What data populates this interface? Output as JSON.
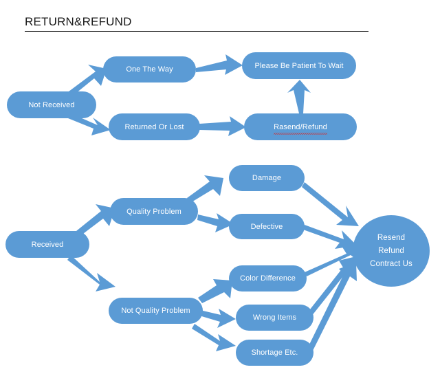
{
  "document": {
    "title": "RETURN&REFUND",
    "has_title_rule": true
  },
  "theme": {
    "node_fill": "#5B9BD5",
    "node_text": "#FFFFFF",
    "arrow_fill": "#5B9BD5",
    "page_background": "#FFFFFF",
    "title_text": "#1A1A1A",
    "spellcheck_underline": "#D42B2B"
  },
  "diagram": {
    "type": "flowchart",
    "branches": [
      {
        "name": "not-received-branch",
        "root": "Not Received",
        "steps": [
          "One The Way",
          "Returned Or Lost",
          "Please Be Patient To Wait",
          "Rasend/Refund"
        ]
      },
      {
        "name": "received-branch",
        "root": "Received",
        "steps": [
          "Quality Problem",
          "Not Quality Problem",
          "Damage",
          "Defective",
          "Color Difference",
          "Wrong Items",
          "Shortage Etc.",
          "Resend Refund Contract Us"
        ]
      }
    ],
    "nodes": [
      {
        "id": "not-received",
        "label": "Not Received",
        "shape": "rounded-rect"
      },
      {
        "id": "one-the-way",
        "label": "One The Way",
        "shape": "rounded-rect"
      },
      {
        "id": "returned-or-lost",
        "label": "Returned Or Lost",
        "shape": "rounded-rect"
      },
      {
        "id": "please-be-patient",
        "label": "Please Be Patient To Wait",
        "shape": "rounded-rect"
      },
      {
        "id": "rasend-refund",
        "label": "Rasend/Refund",
        "shape": "rounded-rect",
        "misspelled": true
      },
      {
        "id": "received",
        "label": "Received",
        "shape": "rounded-rect"
      },
      {
        "id": "quality-problem",
        "label": "Quality Problem",
        "shape": "rounded-rect"
      },
      {
        "id": "not-quality-problem",
        "label": "Not Quality Problem",
        "shape": "rounded-rect"
      },
      {
        "id": "damage",
        "label": "Damage",
        "shape": "rounded-rect"
      },
      {
        "id": "defective",
        "label": "Defective",
        "shape": "rounded-rect"
      },
      {
        "id": "color-difference",
        "label": "Color Difference",
        "shape": "rounded-rect"
      },
      {
        "id": "wrong-items",
        "label": "Wrong Items",
        "shape": "rounded-rect"
      },
      {
        "id": "shortage-etc",
        "label": "Shortage Etc.",
        "shape": "rounded-rect"
      },
      {
        "id": "resend-refund-contact",
        "label": "Resend Refund Contract Us",
        "shape": "ellipse",
        "lines": [
          "Resend",
          "Refund",
          "Contract Us"
        ]
      }
    ],
    "edges": [
      {
        "from": "not-received",
        "to": "one-the-way"
      },
      {
        "from": "not-received",
        "to": "returned-or-lost"
      },
      {
        "from": "one-the-way",
        "to": "please-be-patient"
      },
      {
        "from": "returned-or-lost",
        "to": "rasend-refund"
      },
      {
        "from": "rasend-refund",
        "to": "please-be-patient"
      },
      {
        "from": "received",
        "to": "quality-problem"
      },
      {
        "from": "received",
        "to": "not-quality-problem"
      },
      {
        "from": "quality-problem",
        "to": "damage"
      },
      {
        "from": "quality-problem",
        "to": "defective"
      },
      {
        "from": "not-quality-problem",
        "to": "color-difference"
      },
      {
        "from": "not-quality-problem",
        "to": "wrong-items"
      },
      {
        "from": "not-quality-problem",
        "to": "shortage-etc"
      },
      {
        "from": "damage",
        "to": "resend-refund-contact"
      },
      {
        "from": "defective",
        "to": "resend-refund-contact"
      },
      {
        "from": "color-difference",
        "to": "resend-refund-contact"
      },
      {
        "from": "wrong-items",
        "to": "resend-refund-contact"
      },
      {
        "from": "shortage-etc",
        "to": "resend-refund-contact"
      }
    ]
  },
  "node_text": {
    "not_received": "Not Received",
    "one_the_way": "One The Way",
    "returned_or_lost": "Returned Or Lost",
    "please_be_patient": "Please Be Patient To Wait",
    "rasend_refund": "Rasend/Refund",
    "received": "Received",
    "quality_problem": "Quality Problem",
    "not_quality_problem": "Not Quality Problem",
    "damage": "Damage",
    "defective": "Defective",
    "color_difference": "Color Difference",
    "wrong_items": "Wrong Items",
    "shortage_etc": "Shortage Etc.",
    "resend": "Resend",
    "refund": "Refund",
    "contract_us": "Contract Us"
  }
}
